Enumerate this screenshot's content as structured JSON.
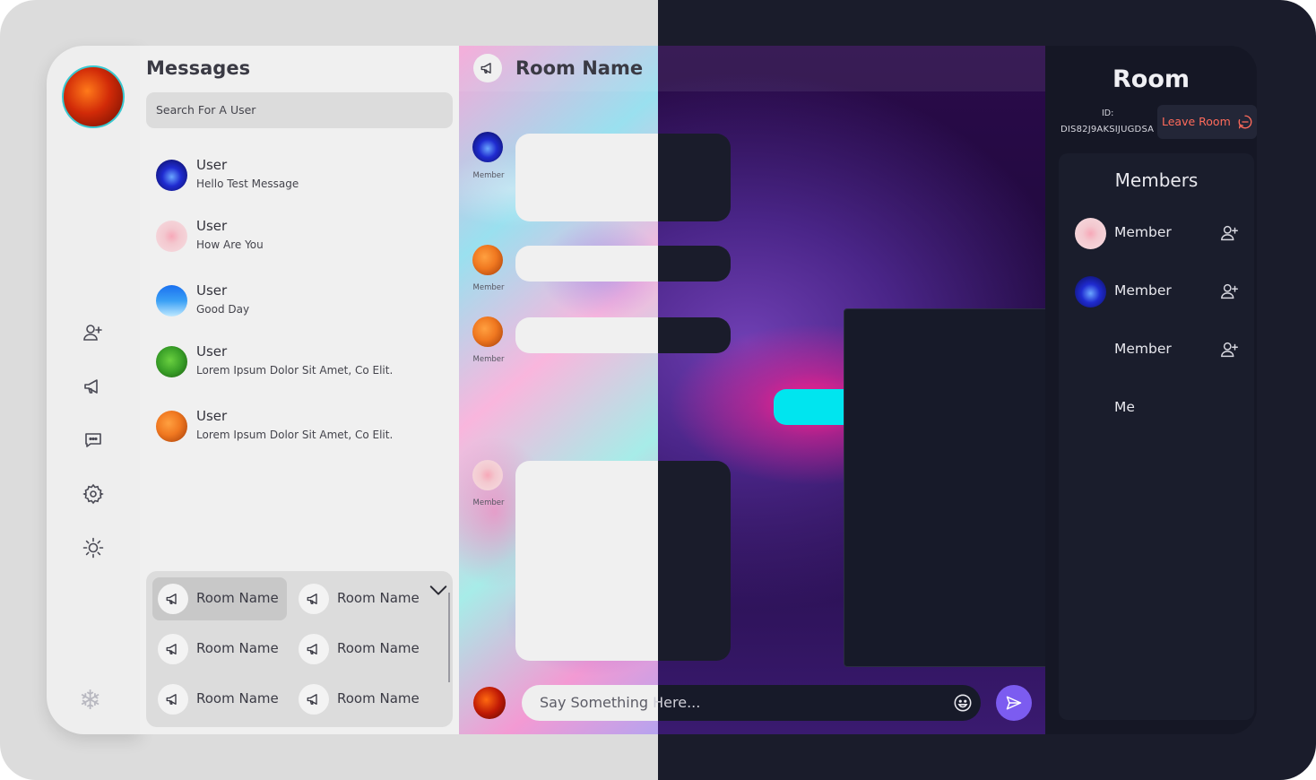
{
  "colors": {
    "accent": "#7c5cf0",
    "leave": "#ff6b5b",
    "cyan": "#00e5ef",
    "dark": "#1a1c2b",
    "light": "#f0f0f0"
  },
  "rail": {
    "icons": [
      "add-friend-icon",
      "megaphone-icon",
      "chat-icon",
      "gear-icon",
      "brightness-icon",
      "snowflake-icon"
    ]
  },
  "messages": {
    "title": "Messages",
    "search_placeholder": "Search For A User",
    "conversations": [
      {
        "name": "User",
        "text": "Hello Test Message",
        "avatar_color": "#1f2bd0"
      },
      {
        "name": "User",
        "text": "How Are You",
        "avatar_color": "#f3c8cf"
      },
      {
        "name": "User",
        "text": "Good Day",
        "avatar_color": "#3aa0f5"
      },
      {
        "name": "User",
        "text": "Lorem Ipsum Dolor Sit Amet, Co Elit.",
        "avatar_color": "#3aa028"
      },
      {
        "name": "User",
        "text": "Lorem Ipsum Dolor Sit Amet, Co Elit.",
        "avatar_color": "#f07820"
      }
    ],
    "rooms": [
      "Room Name",
      "Room Name",
      "Room Name",
      "Room Name",
      "Room Name",
      "Room Name"
    ]
  },
  "chat": {
    "title": "Room Name",
    "member_label": "Member",
    "composer_placeholder_light": "Say Something ",
    "composer_placeholder_dark": "Here...",
    "members": [
      "Member",
      "Member",
      "Member",
      "Member"
    ]
  },
  "room_panel": {
    "title": "Room",
    "id_label": "ID:",
    "id_value": "DIS82J9AKSIJUGDSA",
    "leave_label": "Leave Room",
    "members_title": "Members",
    "members": [
      {
        "name": "Member",
        "avatar_color": "#f3c8cf"
      },
      {
        "name": "Member",
        "avatar_color": "#1f2bd0"
      },
      {
        "name": "Member",
        "avatar_color": ""
      },
      {
        "name": "Me",
        "avatar_color": ""
      }
    ]
  }
}
